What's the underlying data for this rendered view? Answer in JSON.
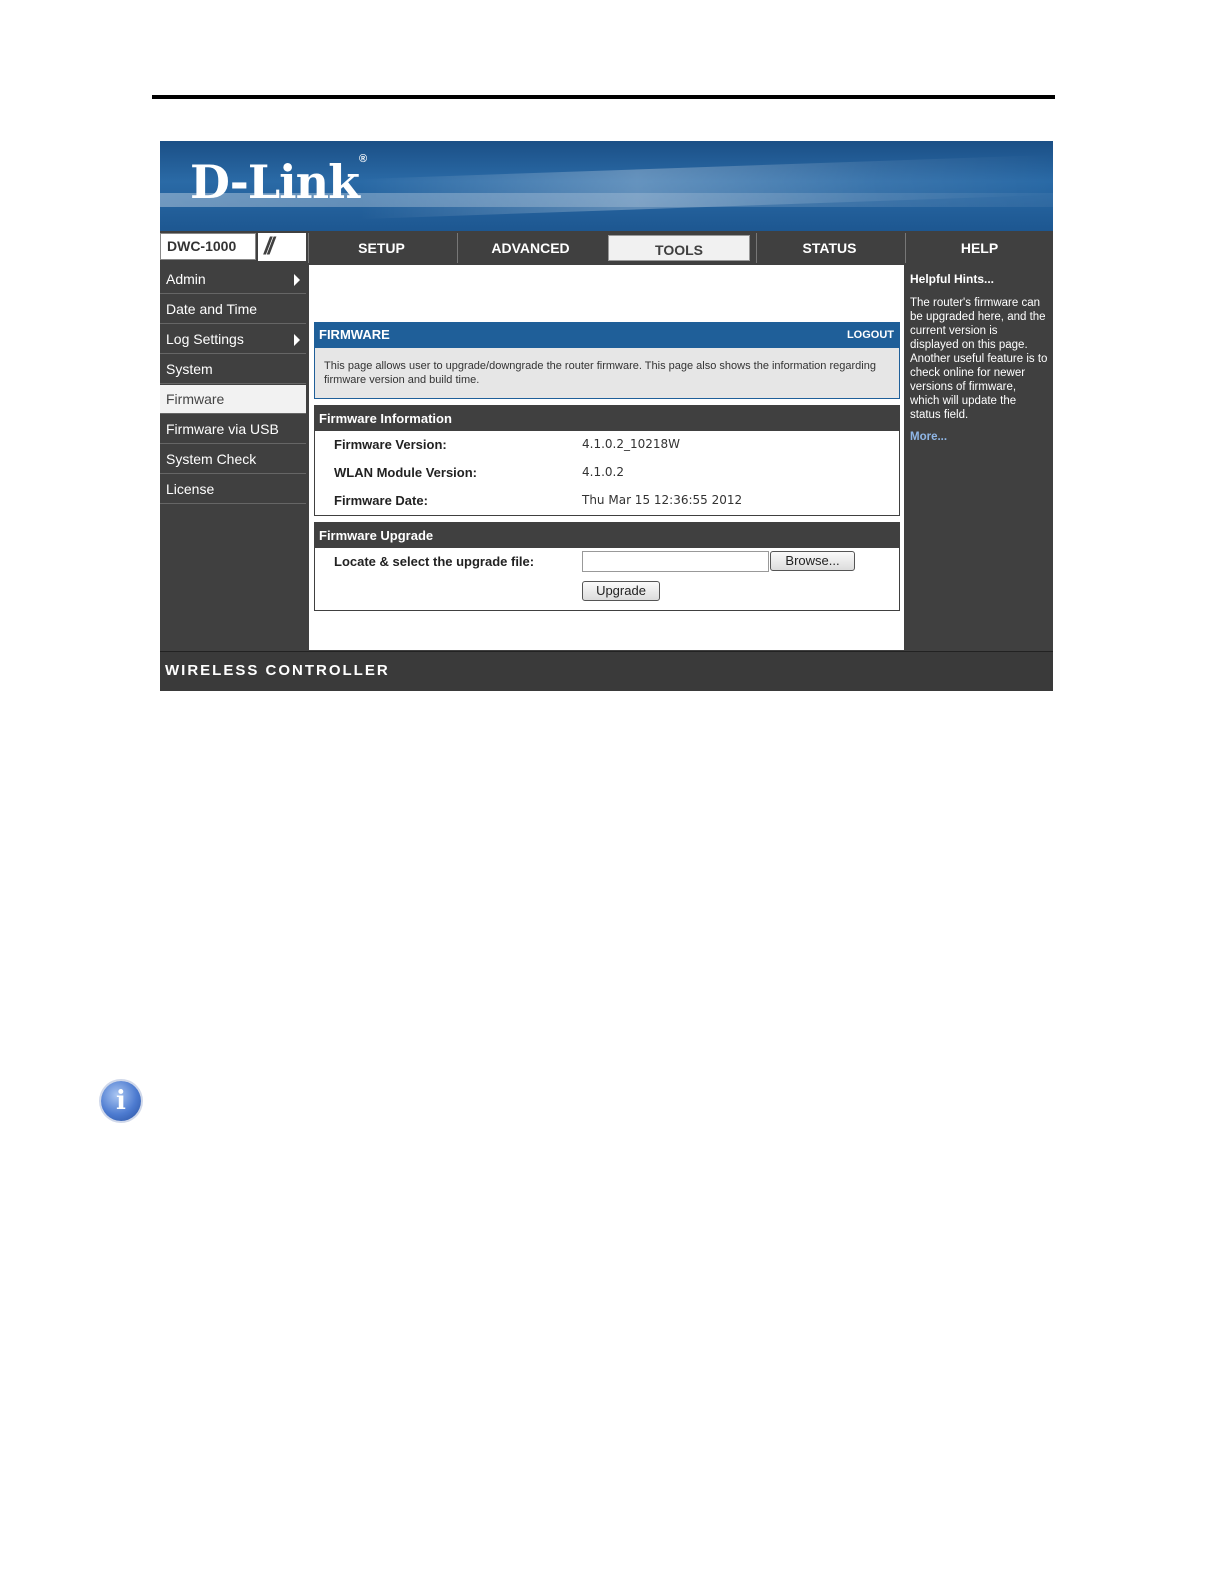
{
  "brand": {
    "logo_text": "D-Link",
    "registered_mark": "®"
  },
  "header": {
    "model": "DWC-1000",
    "slashes": "//"
  },
  "nav": {
    "tabs": [
      {
        "label": "SETUP"
      },
      {
        "label": "ADVANCED"
      },
      {
        "label": "TOOLS",
        "active": true
      },
      {
        "label": "STATUS"
      },
      {
        "label": "HELP"
      }
    ]
  },
  "sidebar": {
    "items": [
      {
        "label": "Admin",
        "has_submenu": true
      },
      {
        "label": "Date and Time"
      },
      {
        "label": "Log Settings",
        "has_submenu": true
      },
      {
        "label": "System"
      },
      {
        "label": "Firmware",
        "active": true
      },
      {
        "label": "Firmware via USB"
      },
      {
        "label": "System Check"
      },
      {
        "label": "License"
      }
    ]
  },
  "panel": {
    "title": "FIRMWARE",
    "logout_label": "LOGOUT",
    "description": "This page allows user to upgrade/downgrade the router firmware. This page also shows the information regarding firmware version and build time."
  },
  "firmware_info": {
    "title": "Firmware Information",
    "rows": [
      {
        "label": "Firmware Version:",
        "value": "4.1.0.2_10218W"
      },
      {
        "label": "WLAN Module Version:",
        "value": "4.1.0.2"
      },
      {
        "label": "Firmware Date:",
        "value": "Thu Mar 15 12:36:55 2012"
      }
    ]
  },
  "firmware_upgrade": {
    "title": "Firmware Upgrade",
    "file_label": "Locate & select the upgrade file:",
    "file_value": "",
    "browse_label": "Browse...",
    "upgrade_label": "Upgrade"
  },
  "help": {
    "title": "Helpful Hints...",
    "text": "The router's firmware can be upgraded here, and the current version is displayed on this page. Another useful feature is to check online for newer versions of firmware, which will update the status field.",
    "more_label": "More..."
  },
  "footer": {
    "text": "WIRELESS CONTROLLER"
  },
  "page": {
    "info_icon_glyph": "i"
  },
  "colors": {
    "banner": "#1f5f99",
    "chrome": "#404040",
    "panel_head": "#1f5f99",
    "link": "#8fb6e6"
  }
}
